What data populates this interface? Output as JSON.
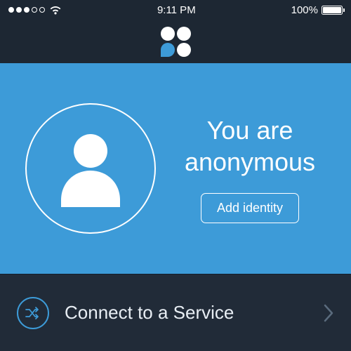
{
  "status": {
    "time": "9:11 PM",
    "battery_percent": "100%"
  },
  "hero": {
    "title_line1": "You are",
    "title_line2": "anonymous",
    "add_identity_label": "Add identity"
  },
  "row": {
    "connect_label": "Connect to a Service"
  },
  "colors": {
    "bg_dark": "#1d2733",
    "row_bg": "#212b38",
    "accent": "#3d9bd8",
    "white": "#ffffff"
  }
}
